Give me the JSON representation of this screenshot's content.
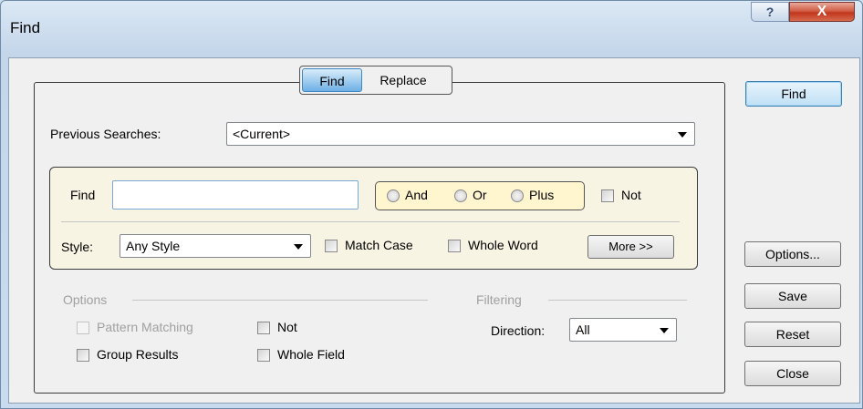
{
  "window": {
    "title": "Find",
    "help_label": "?",
    "close_label": "X"
  },
  "tabs": [
    {
      "label": "Find",
      "active": true
    },
    {
      "label": "Replace",
      "active": false
    }
  ],
  "previous_searches": {
    "label": "Previous Searches:",
    "value": "<Current>"
  },
  "find_section": {
    "find_label": "Find",
    "find_value": "",
    "logic_options": [
      "And",
      "Or",
      "Plus"
    ],
    "not_label": "Not",
    "style_label": "Style:",
    "style_value": "Any Style",
    "match_case_label": "Match Case",
    "whole_word_label": "Whole Word",
    "more_label": "More >>"
  },
  "options": {
    "header": "Options",
    "pattern_matching_label": "Pattern Matching",
    "not_label": "Not",
    "group_results_label": "Group Results",
    "whole_field_label": "Whole Field"
  },
  "filtering": {
    "header": "Filtering",
    "direction_label": "Direction:",
    "direction_value": "All"
  },
  "side_buttons": {
    "find": "Find",
    "options": "Options...",
    "save": "Save",
    "reset": "Reset",
    "close": "Close"
  }
}
